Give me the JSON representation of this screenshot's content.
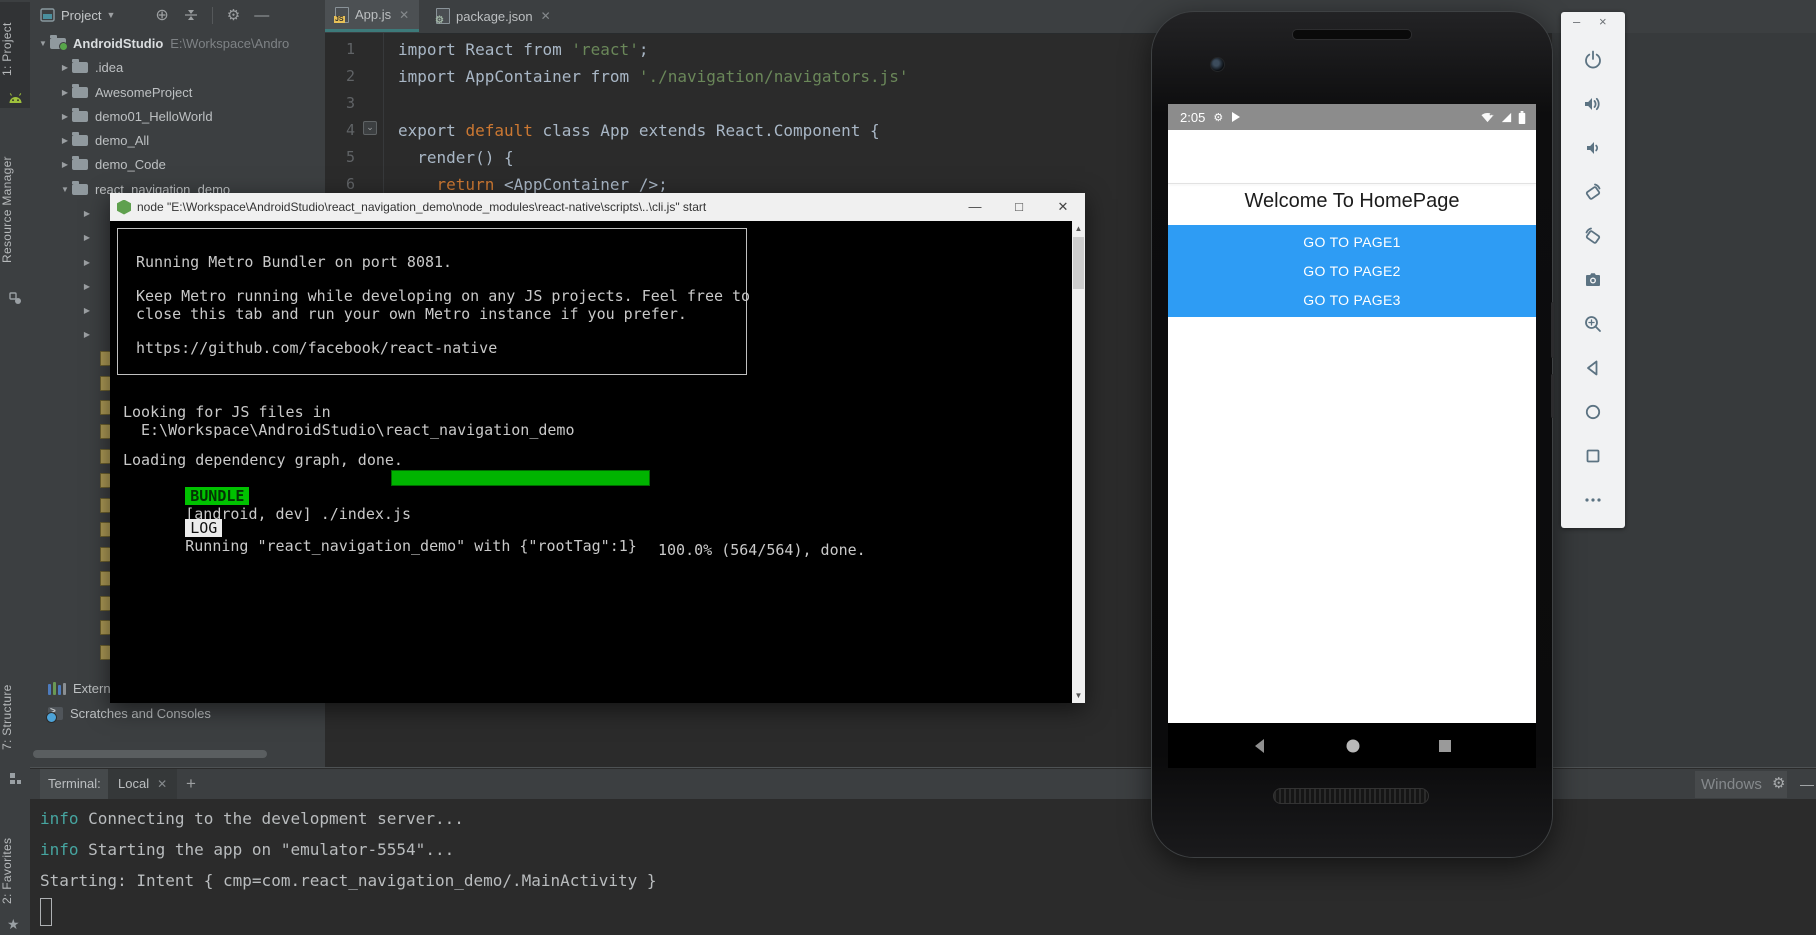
{
  "left_strip": {
    "project_label": "1: Project",
    "resource_manager_label": "Resource Manager",
    "structure_label": "7: Structure",
    "favorites_label": "2: Favorites"
  },
  "project_panel": {
    "header_title": "Project",
    "tree": {
      "root_label": "AndroidStudio",
      "root_path": "E:\\Workspace\\Andro",
      "items": [
        ".idea",
        "AwesomeProject",
        "demo01_HelloWorld",
        "demo_All",
        "demo_Code",
        "react_navigation_demo"
      ],
      "external_libraries": "External Libraries",
      "scratches": "Scratches and Consoles"
    }
  },
  "editor": {
    "tabs": [
      {
        "label": "App.js"
      },
      {
        "label": "package.json"
      }
    ],
    "code": [
      {
        "num": "1",
        "seg": [
          {
            "t": "import React from "
          },
          {
            "t": "'react'"
          },
          {
            "t": ";"
          }
        ]
      },
      {
        "num": "2",
        "seg": [
          {
            "t": "import AppContainer from "
          },
          {
            "t": "'./navigation/navigators.js'"
          }
        ]
      },
      {
        "num": "3",
        "seg": [
          {
            "t": ""
          }
        ]
      },
      {
        "num": "4",
        "seg": [
          {
            "t": "export "
          },
          {
            "t": "default"
          },
          {
            "t": " class App extends React.Component {"
          }
        ]
      },
      {
        "num": "5",
        "seg": [
          {
            "t": "  render() {"
          }
        ]
      },
      {
        "num": "6",
        "seg": [
          {
            "t": "    "
          },
          {
            "t": "return"
          },
          {
            "t": " <AppContainer />;"
          }
        ]
      }
    ]
  },
  "cmd": {
    "title": "node  \"E:\\Workspace\\AndroidStudio\\react_navigation_demo\\node_modules\\react-native\\scripts\\..\\cli.js\" start",
    "minimize": "—",
    "maximize": "□",
    "close": "✕",
    "box_lines": [
      "Running Metro Bundler on port 8081.",
      "Keep Metro running while developing on any JS projects. Feel free to",
      "close this tab and run your own Metro instance if you prefer.",
      "https://github.com/facebook/react-native"
    ],
    "looking1": "Looking for JS files in",
    "looking2": "E:\\Workspace\\AndroidStudio\\react_navigation_demo",
    "loading": "Loading dependency graph, done.",
    "bundle_badge": "BUNDLE",
    "bundle_text": "[android, dev] ./index.js",
    "bundle_pct": "100.0% (564/564), done.",
    "log_badge": "LOG",
    "log_text": "Running \"react_navigation_demo\" with {\"rootTag\":1}"
  },
  "emulator": {
    "status_time": "2:05",
    "title": "Welcome To HomePage",
    "buttons": [
      "GO TO PAGE1",
      "GO TO PAGE2",
      "GO TO PAGE3"
    ],
    "toolbar_icons": [
      "power",
      "volume-up",
      "volume-down",
      "rotate-left",
      "rotate-right",
      "screenshot-camera",
      "zoom",
      "back",
      "home",
      "overview",
      "more"
    ],
    "accent_blue": "#2e9cf4"
  },
  "terminal": {
    "label": "Terminal:",
    "tab": "Local",
    "plus": "+",
    "watermark": "Windows",
    "lines": [
      {
        "prefix": "info",
        "text": " Connecting to the development server..."
      },
      {
        "prefix": "info",
        "text": " Starting the app on \"emulator-5554\"..."
      },
      {
        "prefix": "",
        "text": "Starting: Intent { cmp=com.react_navigation_demo/.MainActivity }"
      }
    ]
  },
  "colors": {
    "panel_bg": "#3c3f41",
    "editor_bg": "#2b2b2b",
    "keyword_orange": "#cc7832",
    "string_green": "#6a8759",
    "bundle_green": "#00c200",
    "info_teal": "#46a5a0",
    "tab_underline": "#3d7a7a",
    "emulator_blue": "#2e9cf4"
  }
}
